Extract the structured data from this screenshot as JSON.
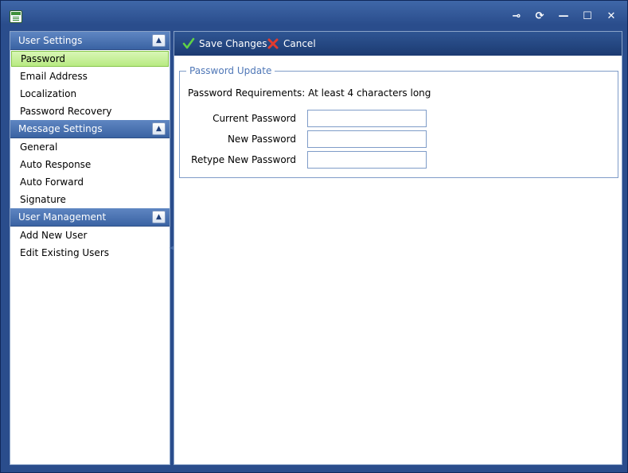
{
  "window": {
    "title_buttons": [
      {
        "name": "pin-icon",
        "glyph": "⊸"
      },
      {
        "name": "refresh-icon",
        "glyph": "⟳"
      },
      {
        "name": "minimize-icon",
        "glyph": "—"
      },
      {
        "name": "maximize-icon",
        "glyph": "☐"
      },
      {
        "name": "close-icon",
        "glyph": "✕"
      }
    ]
  },
  "sidebar": {
    "groups": [
      {
        "title": "User Settings",
        "items": [
          "Password",
          "Email Address",
          "Localization",
          "Password Recovery"
        ]
      },
      {
        "title": "Message Settings",
        "items": [
          "General",
          "Auto Response",
          "Auto Forward",
          "Signature"
        ]
      },
      {
        "title": "User Management",
        "items": [
          "Add New User",
          "Edit Existing Users"
        ]
      }
    ],
    "selected_item": "Password"
  },
  "toolbar": {
    "save_label": "Save Changes",
    "cancel_label": "Cancel"
  },
  "password_update": {
    "legend": "Password Update",
    "requirements": "Password Requirements: At least 4 characters long",
    "fields": [
      {
        "label": "Current Password",
        "value": ""
      },
      {
        "label": "New Password",
        "value": ""
      },
      {
        "label": "Retype New Password",
        "value": ""
      }
    ]
  },
  "colors": {
    "accent": "#2a4d8c",
    "selected": "#b8ea82",
    "legend": "#4f77b7"
  }
}
